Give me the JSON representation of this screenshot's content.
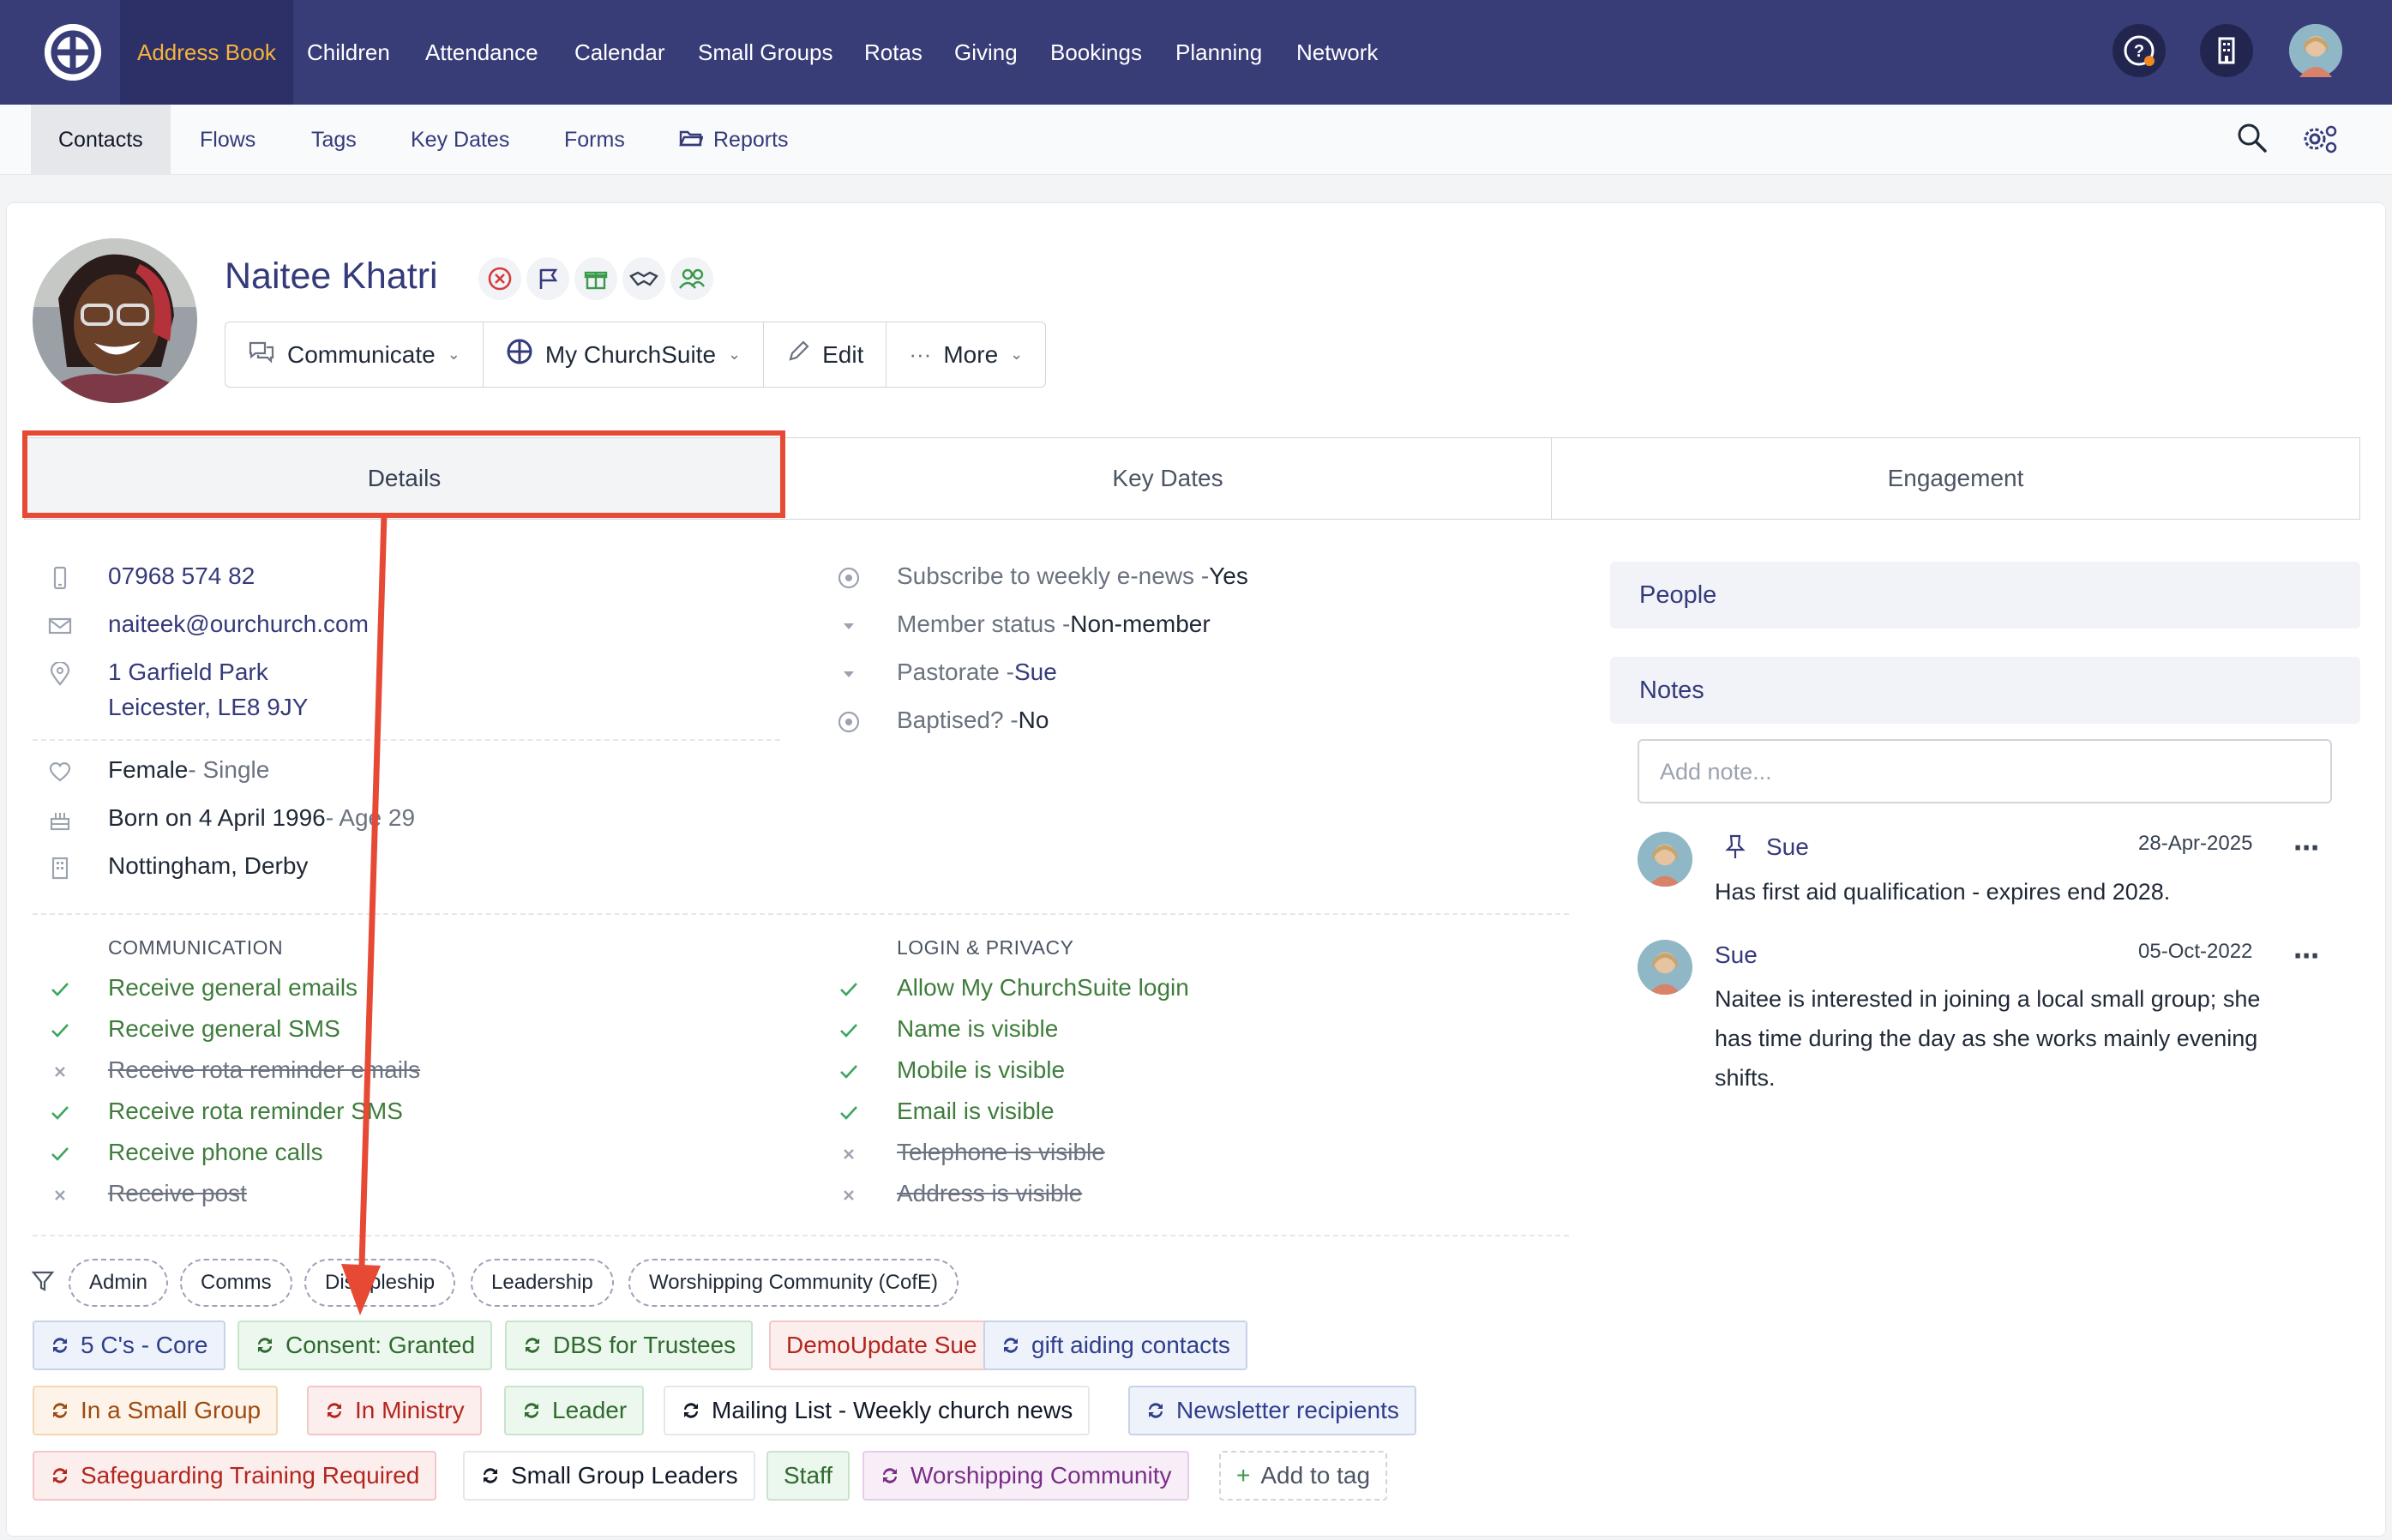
{
  "topnav": {
    "items": [
      "Address Book",
      "Children",
      "Attendance",
      "Calendar",
      "Small Groups",
      "Rotas",
      "Giving",
      "Bookings",
      "Planning",
      "Network"
    ],
    "active": "Address Book",
    "active_color": "#f5b33c",
    "bg_color": "#383c77"
  },
  "subnav": {
    "items": [
      "Contacts",
      "Flows",
      "Tags",
      "Key Dates",
      "Forms",
      "Reports"
    ],
    "active": "Contacts"
  },
  "contact": {
    "name": "Naitee Khatri",
    "actions": {
      "communicate": "Communicate",
      "mychurchsuite": "My ChurchSuite",
      "edit": "Edit",
      "more": "More"
    }
  },
  "tabs": [
    "Details",
    "Key Dates",
    "Engagement"
  ],
  "active_tab": "Details",
  "details": {
    "phone": "07968 574 82",
    "email": "naiteek@ourchurch.com",
    "address_line1": "1 Garfield Park",
    "address_line2": "Leicester, LE8 9JY",
    "sex": "Female",
    "marital": " - Single",
    "born": "Born on 4 April 1996",
    "age": " - Age 29",
    "location": "Nottingham, Derby"
  },
  "fields": [
    {
      "label": "Subscribe to weekly e-news - ",
      "value": "Yes"
    },
    {
      "label": "Member status - ",
      "value": "Non-member"
    },
    {
      "label": "Pastorate - ",
      "value": "Sue"
    },
    {
      "label": "Baptised? - ",
      "value": "No"
    }
  ],
  "communication": {
    "header": "COMMUNICATION",
    "items": [
      {
        "label": "Receive general emails",
        "on": true
      },
      {
        "label": "Receive general SMS",
        "on": true
      },
      {
        "label": "Receive rota reminder emails",
        "on": false
      },
      {
        "label": "Receive rota reminder SMS",
        "on": true
      },
      {
        "label": "Receive phone calls",
        "on": true
      },
      {
        "label": "Receive post",
        "on": false
      }
    ]
  },
  "privacy": {
    "header": "LOGIN & PRIVACY",
    "items": [
      {
        "label": "Allow My ChurchSuite login",
        "on": true
      },
      {
        "label": "Name is visible",
        "on": true
      },
      {
        "label": "Mobile is visible",
        "on": true
      },
      {
        "label": "Email is visible",
        "on": true
      },
      {
        "label": "Telephone is visible",
        "on": false
      },
      {
        "label": "Address is visible",
        "on": false
      }
    ]
  },
  "filter_tags": [
    "Admin",
    "Comms",
    "Discipleship",
    "Leadership",
    "Worshipping Community (CofE)"
  ],
  "tags": [
    {
      "label": "5 C's - Core",
      "style": "blue",
      "icon": true
    },
    {
      "label": "Consent: Granted",
      "style": "green",
      "icon": true
    },
    {
      "label": "DBS for Trustees",
      "style": "green",
      "icon": true
    },
    {
      "label": "DemoUpdate Sue",
      "style": "red",
      "icon": false
    },
    {
      "label": "gift aiding contacts",
      "style": "blue",
      "icon": true
    },
    {
      "label": "In a Small Group",
      "style": "orange",
      "icon": true
    },
    {
      "label": "In Ministry",
      "style": "red",
      "icon": true
    },
    {
      "label": "Leader",
      "style": "green",
      "icon": true
    },
    {
      "label": "Mailing List - Weekly church news",
      "style": "white",
      "icon": true
    },
    {
      "label": "Newsletter recipients",
      "style": "blue",
      "icon": true
    },
    {
      "label": "Safeguarding Training Required",
      "style": "red",
      "icon": true
    },
    {
      "label": "Small Group Leaders",
      "style": "white",
      "icon": true
    },
    {
      "label": "Staff",
      "style": "green",
      "icon": false
    },
    {
      "label": "Worshipping Community",
      "style": "purple",
      "icon": true
    }
  ],
  "add_tag": "Add to tag",
  "sidebar": {
    "people": "People",
    "notes": "Notes",
    "note_placeholder": "Add note...",
    "notes_list": [
      {
        "author": "Sue",
        "date": "28-Apr-2025",
        "pinned": true,
        "text": "Has first aid qualification - expires end 2028."
      },
      {
        "author": "Sue",
        "date": "05-Oct-2022",
        "pinned": false,
        "text": "Naitee is interested in joining a local small group; she has time during the day as she works mainly evening shifts."
      }
    ]
  },
  "annotation_color": "#e64a35"
}
